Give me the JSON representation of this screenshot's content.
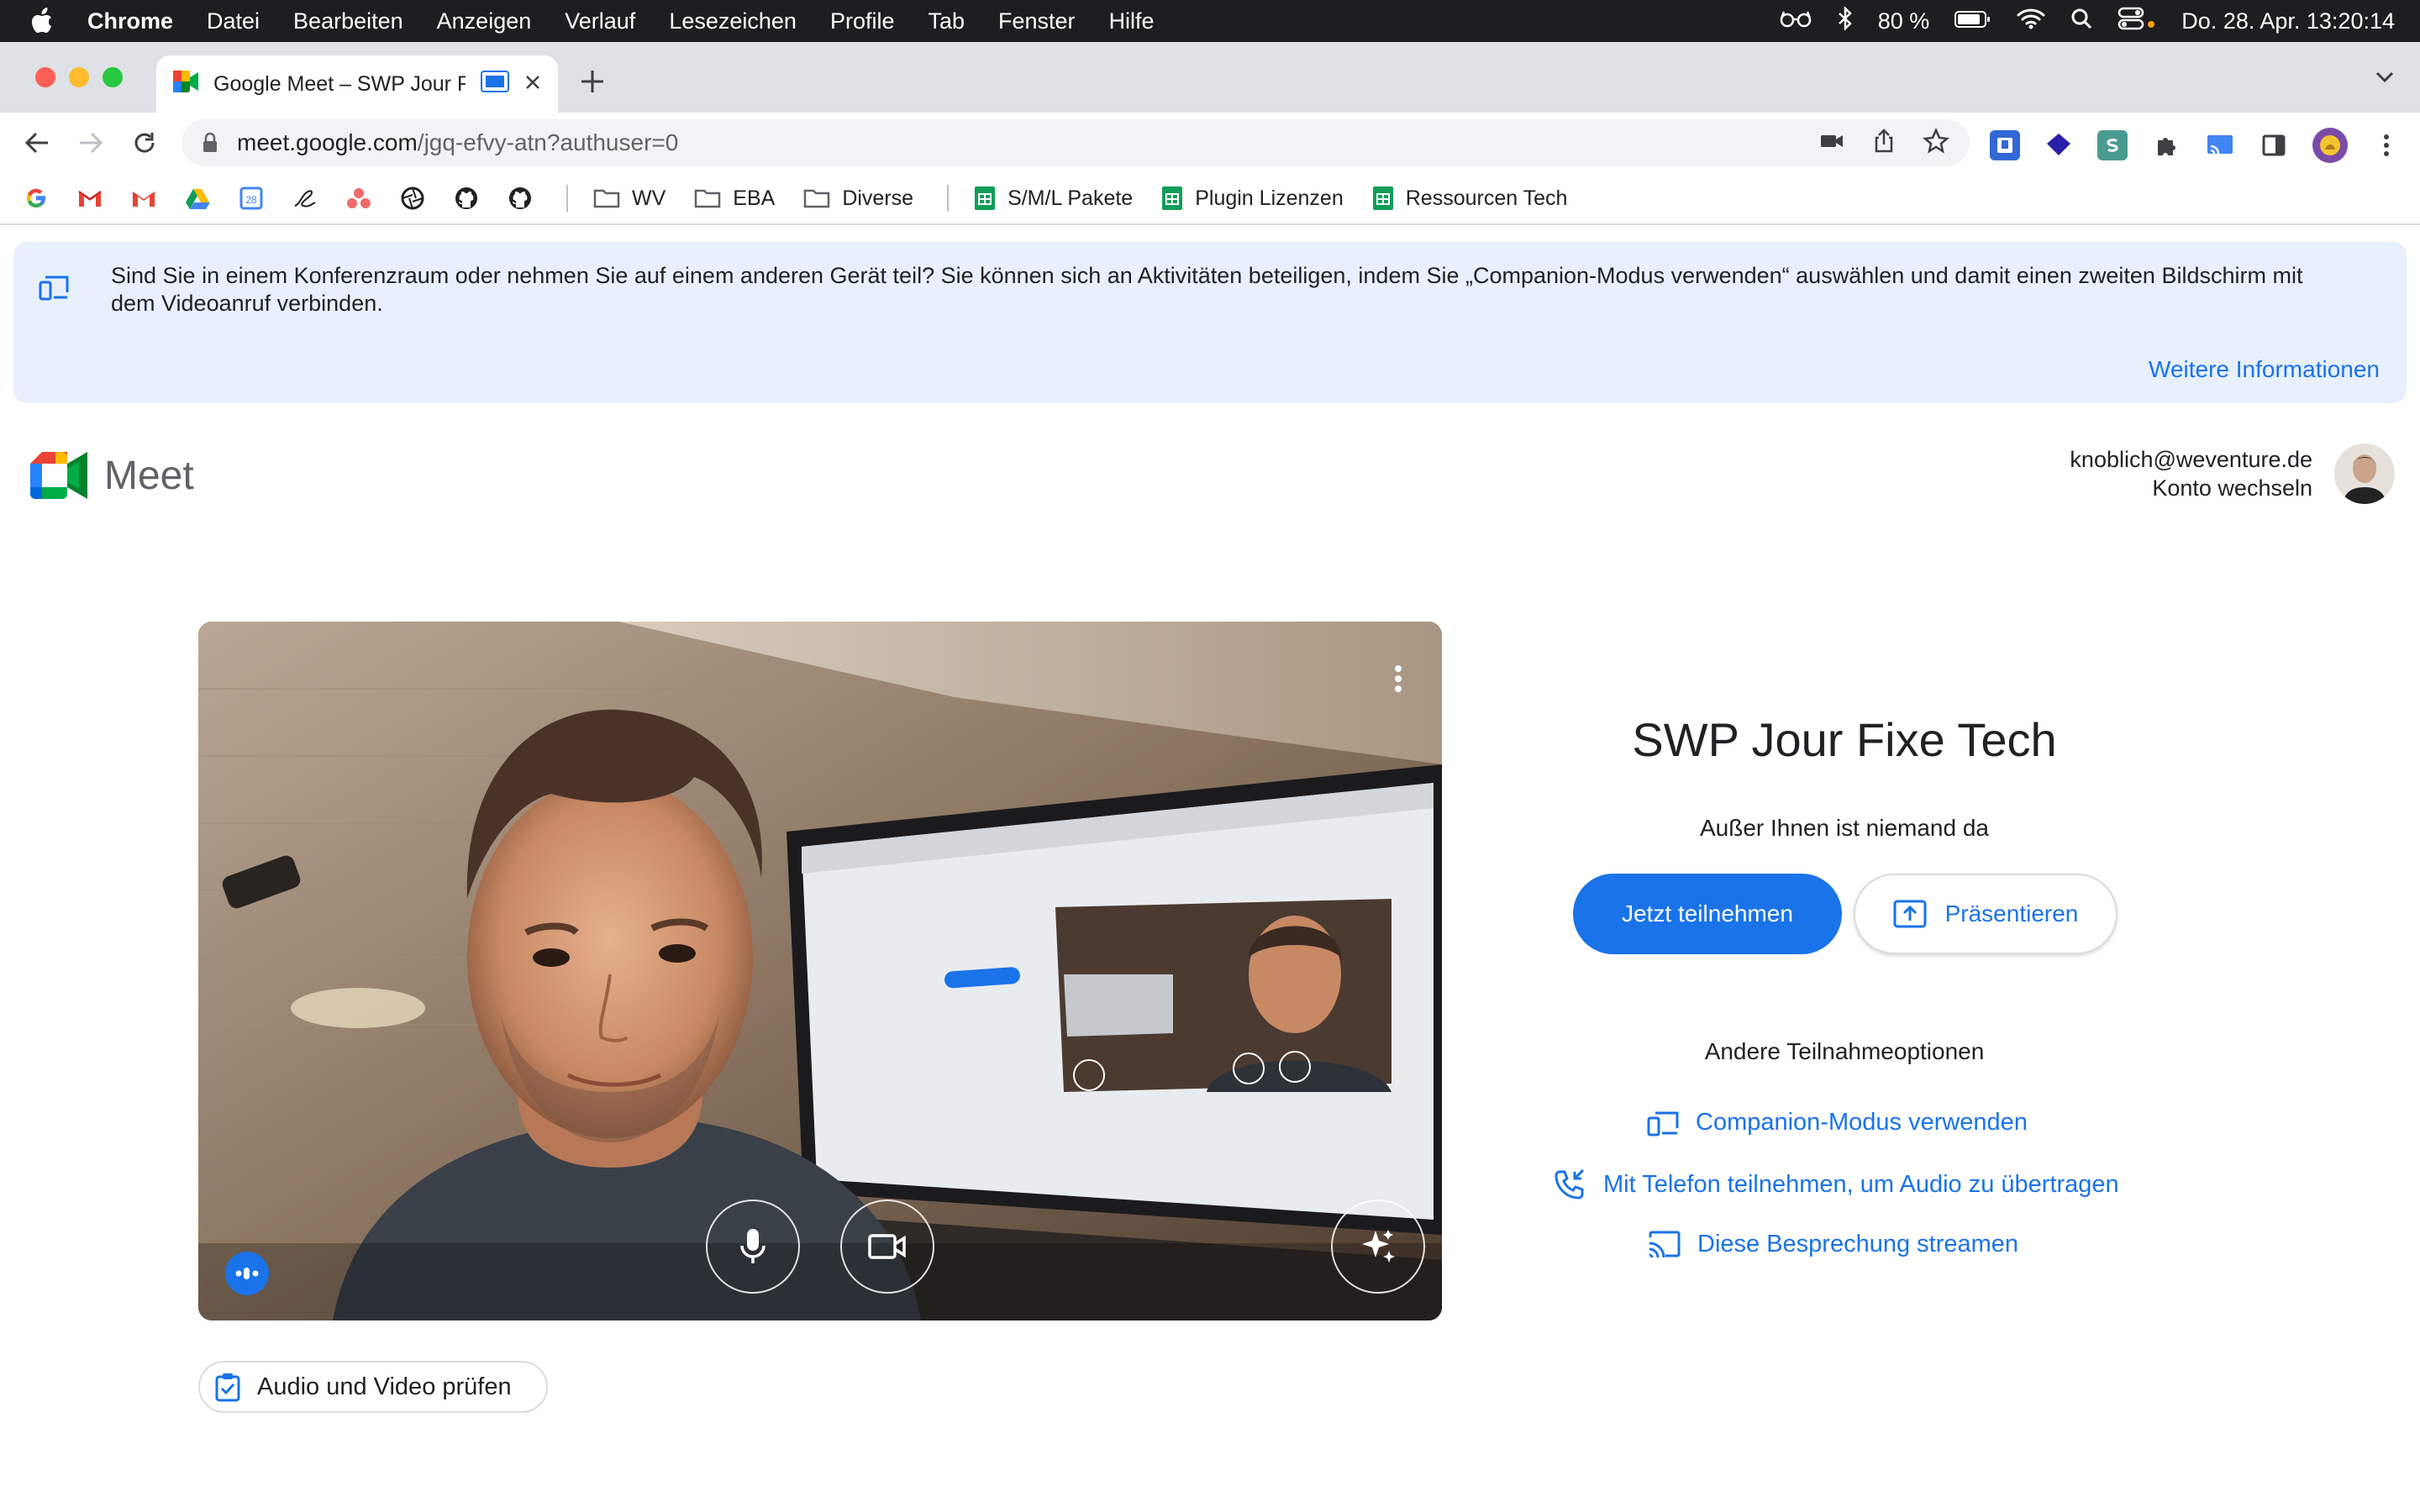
{
  "menubar": {
    "app": "Chrome",
    "items": [
      "Datei",
      "Bearbeiten",
      "Anzeigen",
      "Verlauf",
      "Lesezeichen",
      "Profile",
      "Tab",
      "Fenster",
      "Hilfe"
    ],
    "battery": "80 %",
    "datetime": "Do. 28. Apr.  13:20:14"
  },
  "tab": {
    "title": "Google Meet – SWP Jour F"
  },
  "omnibox": {
    "host": "meet.google.com",
    "path": "/jgq-efvy-atn?authuser=0"
  },
  "bookmarks": {
    "folders": [
      "WV",
      "EBA",
      "Diverse"
    ],
    "sheets": [
      "S/M/L Pakete",
      "Plugin Lizenzen",
      "Ressourcen Tech"
    ]
  },
  "banner": {
    "text": "Sind Sie in einem Konferenzraum oder nehmen Sie auf einem anderen Gerät teil? Sie können sich an Aktivitäten beteiligen, indem Sie „Companion-Modus verwenden“ auswählen und damit einen zweiten Bildschirm mit dem Videoanruf verbinden.",
    "link": "Weitere Informationen"
  },
  "brand": {
    "name": "Meet"
  },
  "account": {
    "email": "knoblich@weventure.de",
    "switch": "Konto wechseln"
  },
  "preview": {
    "check_label": "Audio und Video prüfen"
  },
  "meeting": {
    "title": "SWP Jour Fixe Tech",
    "status": "Außer Ihnen ist niemand da",
    "join": "Jetzt teilnehmen",
    "present": "Präsentieren",
    "other_title": "Andere Teilnahmeoptionen",
    "options": [
      {
        "label": "Companion-Modus verwenden",
        "icon": "companion-icon"
      },
      {
        "label": "Mit Telefon teilnehmen, um Audio zu übertragen",
        "icon": "phone-icon"
      },
      {
        "label": "Diese Besprechung streamen",
        "icon": "cast-icon"
      }
    ]
  },
  "colors": {
    "accent": "#1a73e8",
    "banner_bg": "#e8f0fe",
    "menubar_bg": "#1e1e20"
  }
}
